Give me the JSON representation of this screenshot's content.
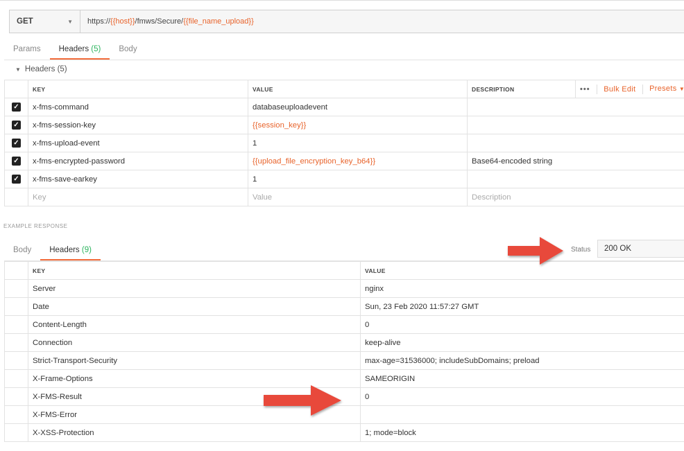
{
  "request": {
    "method": "GET",
    "url_parts": [
      {
        "text": "https://",
        "var": false
      },
      {
        "text": "{{host}}",
        "var": true
      },
      {
        "text": "/fmws/Secure/",
        "var": false
      },
      {
        "text": "{{file_name_upload}}",
        "var": true
      }
    ],
    "tabs": [
      {
        "label": "Params",
        "count": "",
        "active": false
      },
      {
        "label": "Headers",
        "count": "(5)",
        "active": true
      },
      {
        "label": "Body",
        "count": "",
        "active": false
      }
    ],
    "section_title": "Headers (5)",
    "columns": {
      "key": "KEY",
      "value": "VALUE",
      "description": "DESCRIPTION"
    },
    "actions": {
      "more": "•••",
      "bulk_edit": "Bulk Edit",
      "presets": "Presets"
    },
    "rows": [
      {
        "key": "x-fms-command",
        "value": "databaseuploadevent",
        "value_var": false,
        "description": ""
      },
      {
        "key": "x-fms-session-key",
        "value": "{{session_key}}",
        "value_var": true,
        "description": ""
      },
      {
        "key": "x-fms-upload-event",
        "value": "1",
        "value_var": false,
        "description": ""
      },
      {
        "key": "x-fms-encrypted-password",
        "value": "{{upload_file_encryption_key_b64}}",
        "value_var": true,
        "description": "Base64-encoded string"
      },
      {
        "key": "x-fms-save-earkey",
        "value": "1",
        "value_var": false,
        "description": ""
      }
    ],
    "placeholders": {
      "key": "Key",
      "value": "Value",
      "description": "Description"
    }
  },
  "example_label": "EXAMPLE RESPONSE",
  "response": {
    "tabs": [
      {
        "label": "Body",
        "count": "",
        "active": false
      },
      {
        "label": "Headers",
        "count": "(9)",
        "active": true
      }
    ],
    "status_label": "Status",
    "status_value": "200 OK",
    "columns": {
      "key": "KEY",
      "value": "VALUE"
    },
    "rows": [
      {
        "key": "Server",
        "value": "nginx"
      },
      {
        "key": "Date",
        "value": "Sun, 23 Feb 2020 11:57:27 GMT"
      },
      {
        "key": "Content-Length",
        "value": "0"
      },
      {
        "key": "Connection",
        "value": "keep-alive"
      },
      {
        "key": "Strict-Transport-Security",
        "value": "max-age=31536000; includeSubDomains; preload"
      },
      {
        "key": "X-Frame-Options",
        "value": "SAMEORIGIN"
      },
      {
        "key": "X-FMS-Result",
        "value": "0"
      },
      {
        "key": "X-FMS-Error",
        "value": ""
      },
      {
        "key": "X-XSS-Protection",
        "value": "1; mode=block"
      }
    ]
  },
  "colors": {
    "accent": "#e8632b",
    "count_green": "#2cb45e",
    "arrow": "#e8493a"
  }
}
